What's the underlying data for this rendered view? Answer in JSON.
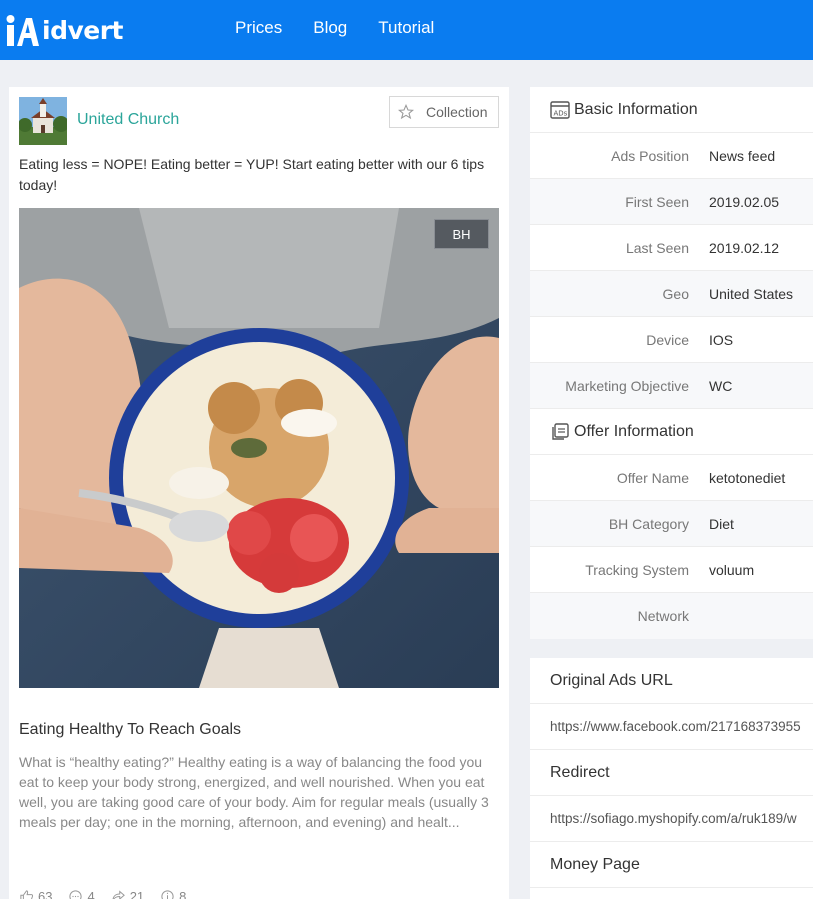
{
  "brand": {
    "logo_text": "idvert",
    "accent": "#0a7cf0"
  },
  "nav": [
    {
      "label": "Prices"
    },
    {
      "label": "Blog"
    },
    {
      "label": "Tutorial"
    }
  ],
  "ad": {
    "page_name": "United Church",
    "collection_label": "Collection",
    "caption": "Eating less = NOPE! Eating better = YUP! Start eating better with our 6 tips today!",
    "badge": "BH",
    "headline": "Eating Healthy To Reach Goals",
    "description": "What is “healthy eating?” Healthy eating is a way of balancing the food you eat to keep your body strong, energized, and well nourished. When you eat well, you are taking good care of your body. Aim for regular meals (usually 3 meals per day; one in the morning, afternoon, and evening) and healt...",
    "stats": {
      "likes": "63",
      "comments": "4",
      "shares": "21",
      "views": "8"
    }
  },
  "basic_info": {
    "title": "Basic Information",
    "rows": [
      {
        "label": "Ads Position",
        "value": "News feed"
      },
      {
        "label": "First Seen",
        "value": "2019.02.05"
      },
      {
        "label": "Last Seen",
        "value": "2019.02.12"
      },
      {
        "label": "Geo",
        "value": "United States"
      },
      {
        "label": "Device",
        "value": "IOS"
      },
      {
        "label": "Marketing Objective",
        "value": "WC"
      }
    ]
  },
  "offer_info": {
    "title": "Offer Information",
    "rows": [
      {
        "label": "Offer Name",
        "value": "ketotonediet"
      },
      {
        "label": "BH Category",
        "value": "Diet"
      },
      {
        "label": "Tracking System",
        "value": "voluum"
      },
      {
        "label": "Network",
        "value": ""
      }
    ]
  },
  "urls": {
    "original_title": "Original Ads URL",
    "original_url": "https://www.facebook.com/217168373955",
    "redirect_title": "Redirect",
    "redirect_url": "https://sofiago.myshopify.com/a/ruk189/w",
    "money_title": "Money Page"
  }
}
